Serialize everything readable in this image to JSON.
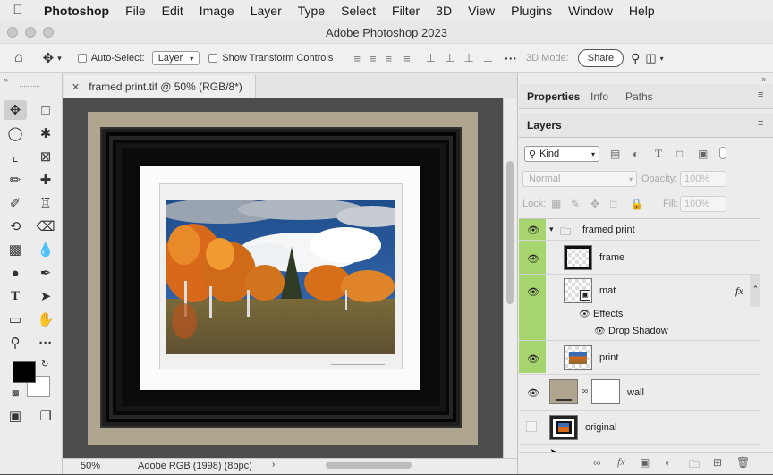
{
  "menubar": {
    "app_name": "Photoshop",
    "items": [
      "File",
      "Edit",
      "Image",
      "Layer",
      "Type",
      "Select",
      "Filter",
      "3D",
      "View",
      "Plugins",
      "Window",
      "Help"
    ]
  },
  "window_title": "Adobe Photoshop 2023",
  "options_bar": {
    "auto_select_label": "Auto-Select:",
    "auto_select_value": "Layer",
    "show_transform_label": "Show Transform Controls",
    "mode_3d_label": "3D Mode:",
    "share_label": "Share"
  },
  "document": {
    "tab_title": "framed print.tif @ 50% (RGB/8*)",
    "zoom": "50%",
    "color_profile": "Adobe RGB (1998) (8bpc)"
  },
  "panels": {
    "top_tabs": [
      "Properties",
      "Info",
      "Paths"
    ],
    "layers_tab": "Layers",
    "filter_kind": "Kind",
    "blend_mode": "Normal",
    "opacity_label": "Opacity:",
    "opacity_value": "100%",
    "lock_label": "Lock:",
    "fill_label": "Fill:",
    "fill_value": "100%"
  },
  "layers": {
    "group": "framed print",
    "frame": "frame",
    "mat": "mat",
    "effects": "Effects",
    "drop_shadow": "Drop Shadow",
    "print": "print",
    "wall": "wall",
    "original": "original",
    "fx_badge": "fx"
  },
  "colors": {
    "accent_green": "#a6d46e",
    "wall": "#b0a58f",
    "panel_bg": "#ececec"
  }
}
